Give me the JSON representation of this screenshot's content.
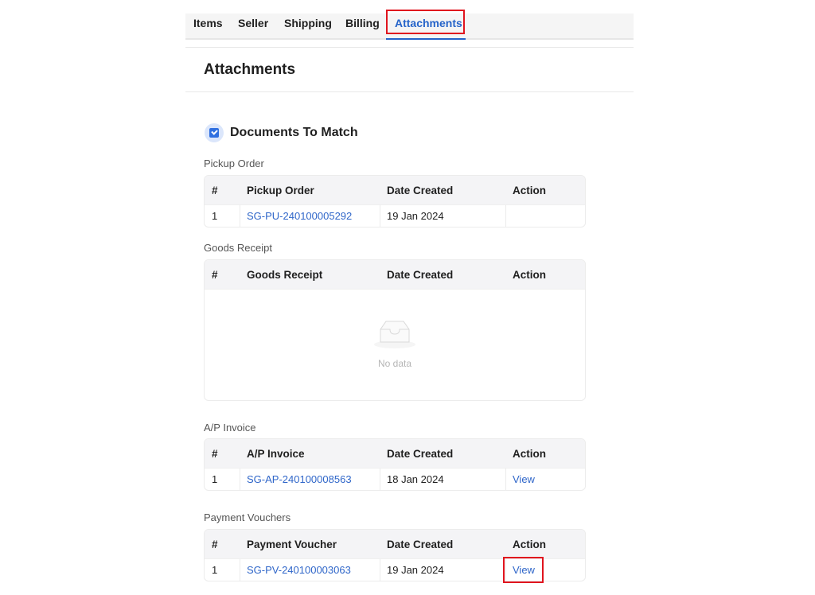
{
  "tabs": [
    {
      "label": "Items"
    },
    {
      "label": "Seller"
    },
    {
      "label": "Shipping"
    },
    {
      "label": "Billing"
    },
    {
      "label": "Attachments",
      "active": true
    }
  ],
  "page_title": "Attachments",
  "section": {
    "title": "Documents To Match",
    "icon": "document-check-icon"
  },
  "pickup": {
    "label": "Pickup Order",
    "headers": [
      "#",
      "Pickup Order",
      "Date Created",
      "Action"
    ],
    "rows": [
      {
        "num": "1",
        "doc": "SG-PU-240100005292",
        "date": "19 Jan 2024",
        "action": ""
      }
    ]
  },
  "goods": {
    "label": "Goods Receipt",
    "headers": [
      "#",
      "Goods Receipt",
      "Date Created",
      "Action"
    ],
    "empty_text": "No data"
  },
  "ap": {
    "label": "A/P Invoice",
    "headers": [
      "#",
      "A/P Invoice",
      "Date Created",
      "Action"
    ],
    "rows": [
      {
        "num": "1",
        "doc": "SG-AP-240100008563",
        "date": "18 Jan 2024",
        "action": "View"
      }
    ]
  },
  "pv": {
    "label": "Payment Vouchers",
    "headers": [
      "#",
      "Payment Voucher",
      "Date Created",
      "Action"
    ],
    "rows": [
      {
        "num": "1",
        "doc": "SG-PV-240100003063",
        "date": "19 Jan 2024",
        "action": "View"
      }
    ]
  },
  "colors": {
    "accent": "#2563c9",
    "highlight": "#e0141e",
    "link": "#2f66c9"
  }
}
